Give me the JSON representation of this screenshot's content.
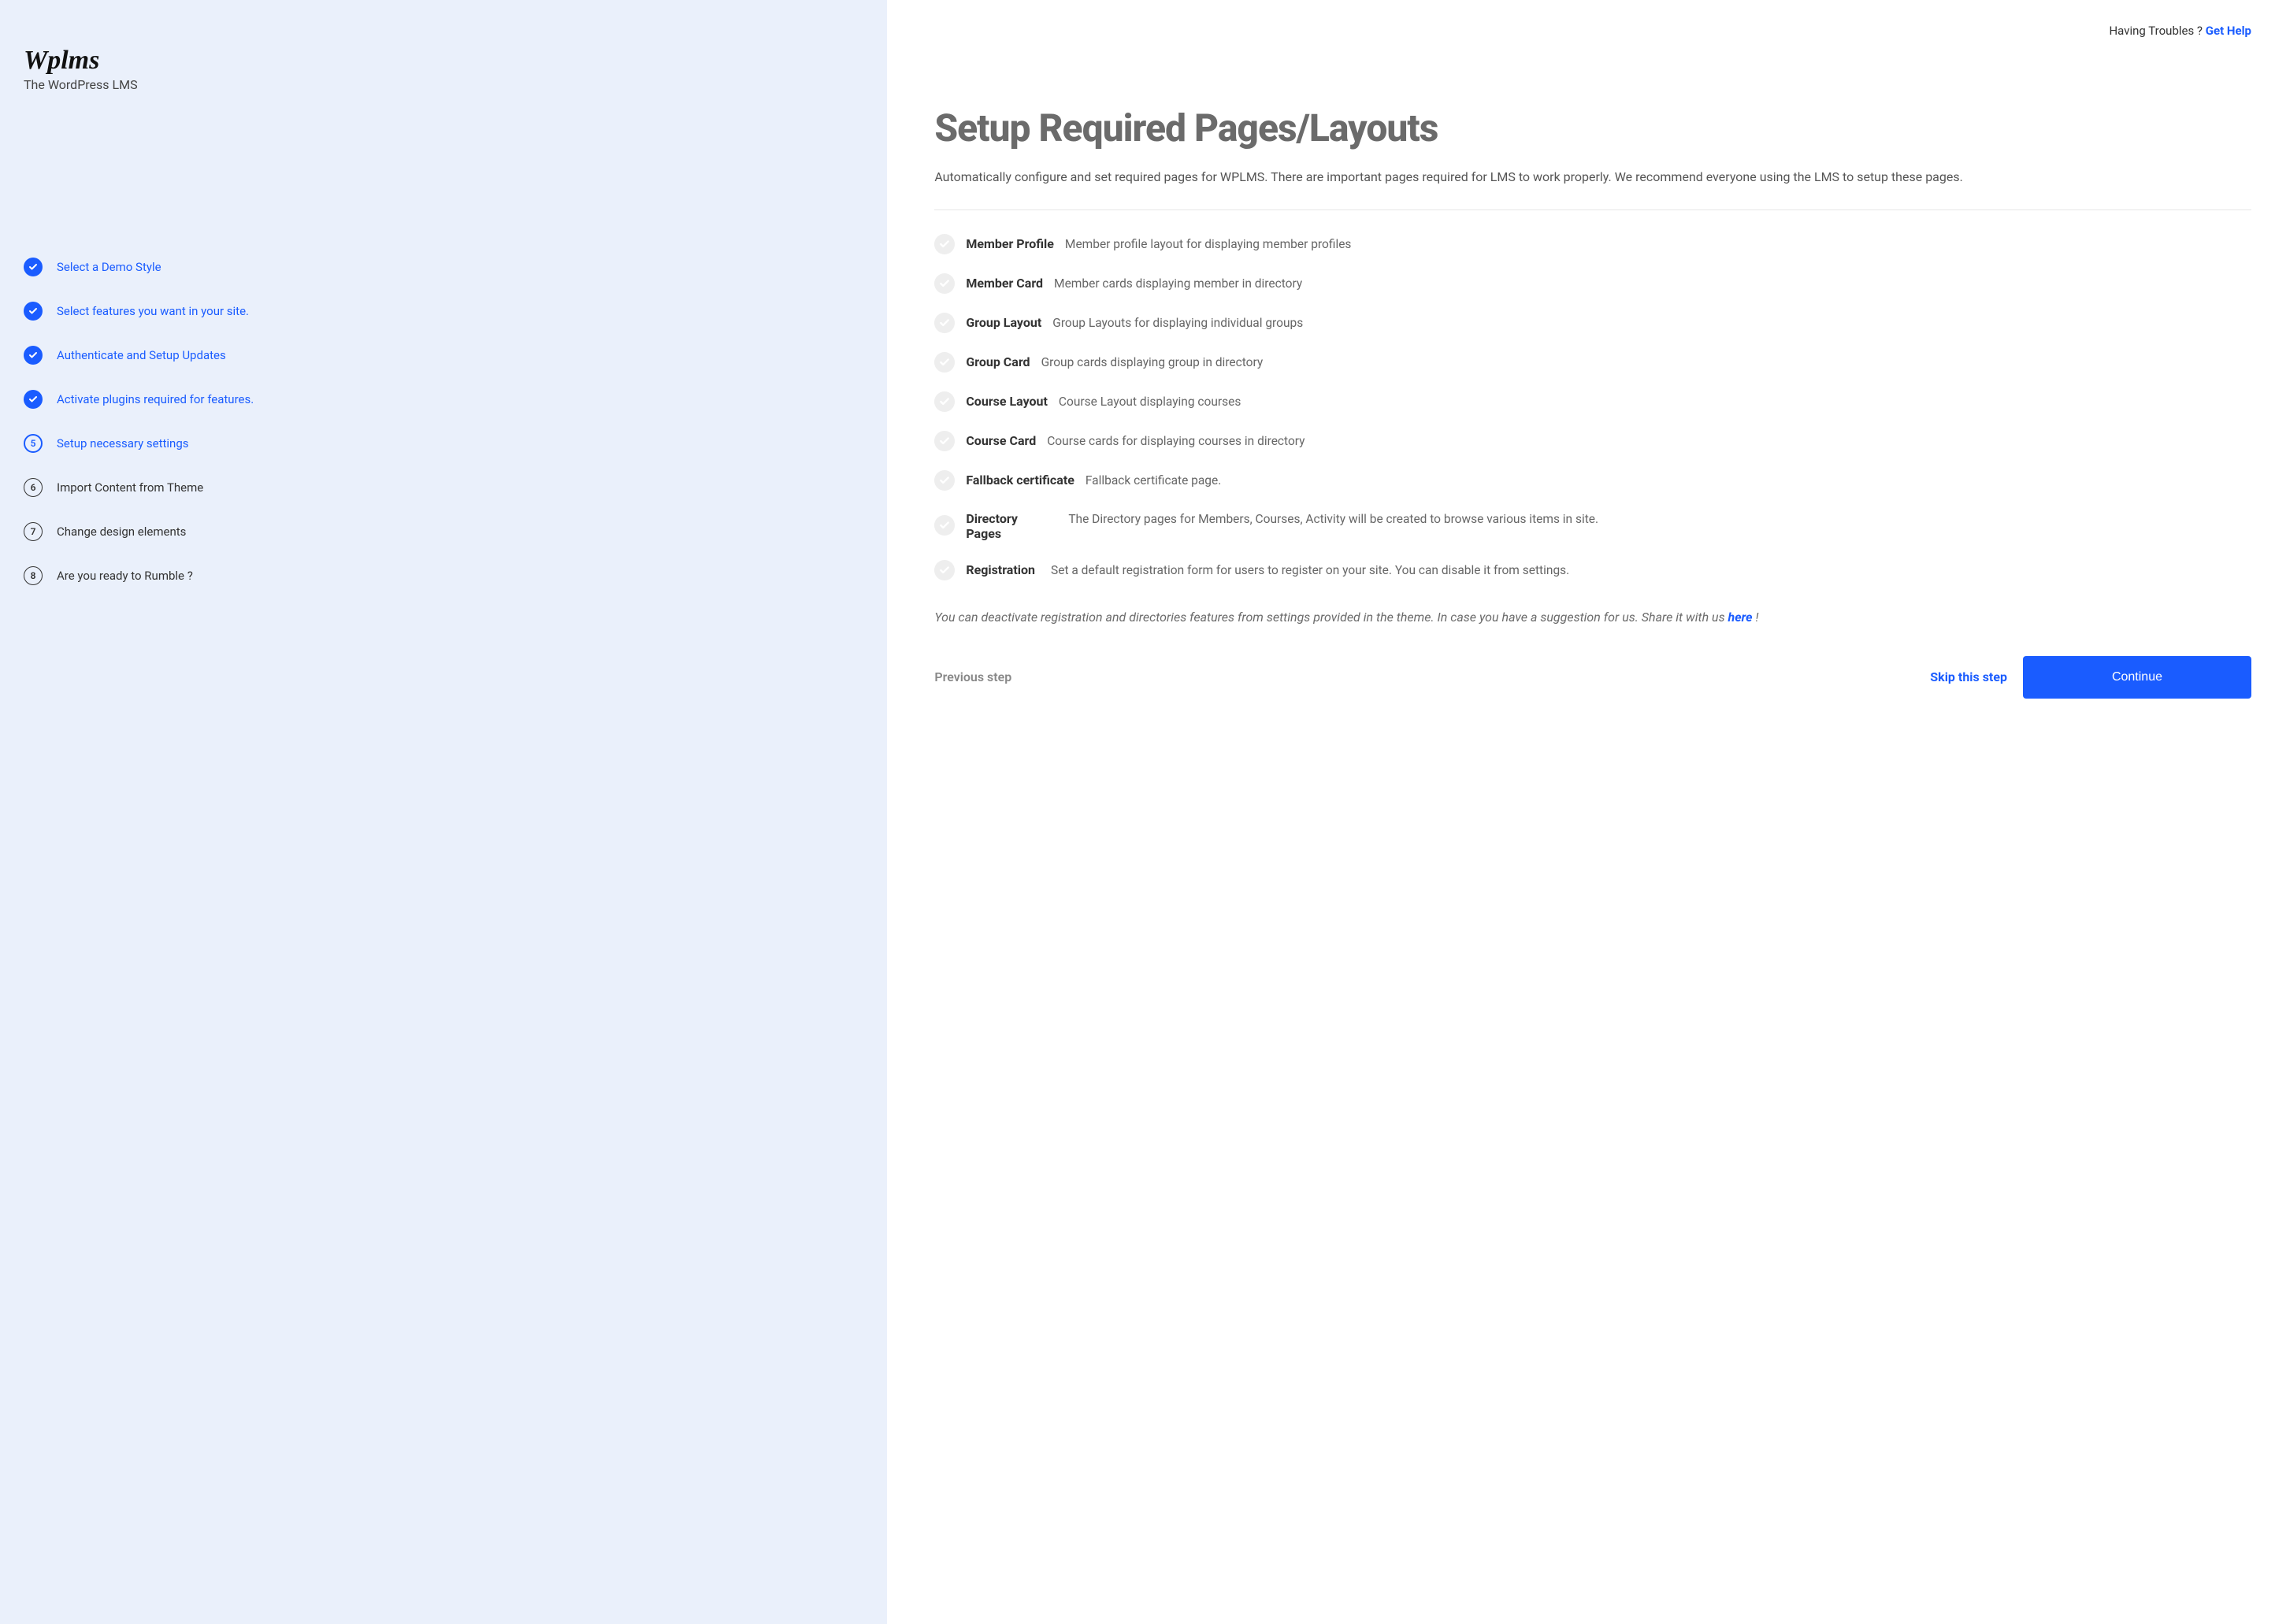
{
  "brand": {
    "logo_text": "Wplms",
    "tagline": "The WordPress LMS"
  },
  "top": {
    "trouble_text": "Having Troubles ? ",
    "help_link": "Get Help"
  },
  "steps": [
    {
      "label": "Select a Demo Style",
      "state": "completed",
      "num": ""
    },
    {
      "label": "Select features you want in your site.",
      "state": "completed",
      "num": ""
    },
    {
      "label": "Authenticate and Setup Updates",
      "state": "completed",
      "num": ""
    },
    {
      "label": "Activate plugins required for features.",
      "state": "completed",
      "num": ""
    },
    {
      "label": "Setup necessary settings",
      "state": "active",
      "num": "5"
    },
    {
      "label": "Import Content from Theme",
      "state": "pending",
      "num": "6"
    },
    {
      "label": "Change design elements",
      "state": "pending",
      "num": "7"
    },
    {
      "label": "Are you ready to Rumble ?",
      "state": "pending",
      "num": "8"
    }
  ],
  "main": {
    "title": "Setup Required Pages/Layouts",
    "description": "Automatically configure and set required pages for WPLMS. There are important pages required for LMS to work properly. We recommend everyone using the LMS to setup these pages.",
    "note_before": "You can deactivate registration and directories features from settings provided in the theme. In case you have a suggestion for us. Share it with us ",
    "note_link": "here",
    "note_after": " !"
  },
  "pages": [
    {
      "name": "Member Profile",
      "desc": "Member profile layout for displaying member profiles",
      "layout": "inline"
    },
    {
      "name": "Member Card",
      "desc": "Member cards displaying member in directory",
      "layout": "inline"
    },
    {
      "name": "Group Layout",
      "desc": "Group Layouts for displaying individual groups",
      "layout": "inline"
    },
    {
      "name": "Group Card",
      "desc": "Group cards displaying group in directory",
      "layout": "inline"
    },
    {
      "name": "Course Layout",
      "desc": "Course Layout displaying courses",
      "layout": "inline"
    },
    {
      "name": "Course Card",
      "desc": "Course cards for displaying courses in directory",
      "layout": "inline"
    },
    {
      "name": "Fallback certificate",
      "desc": "Fallback certificate page.",
      "layout": "inline"
    },
    {
      "name": "Directory Pages",
      "desc": "The Directory pages for Members, Courses, Activity will be created to browse various items in site.",
      "layout": "cols"
    },
    {
      "name": "Registration",
      "desc": "Set a default registration form for users to register on your site. You can disable it from settings.",
      "layout": "cols"
    }
  ],
  "actions": {
    "previous": "Previous step",
    "skip": "Skip this step",
    "continue": "Continue"
  }
}
